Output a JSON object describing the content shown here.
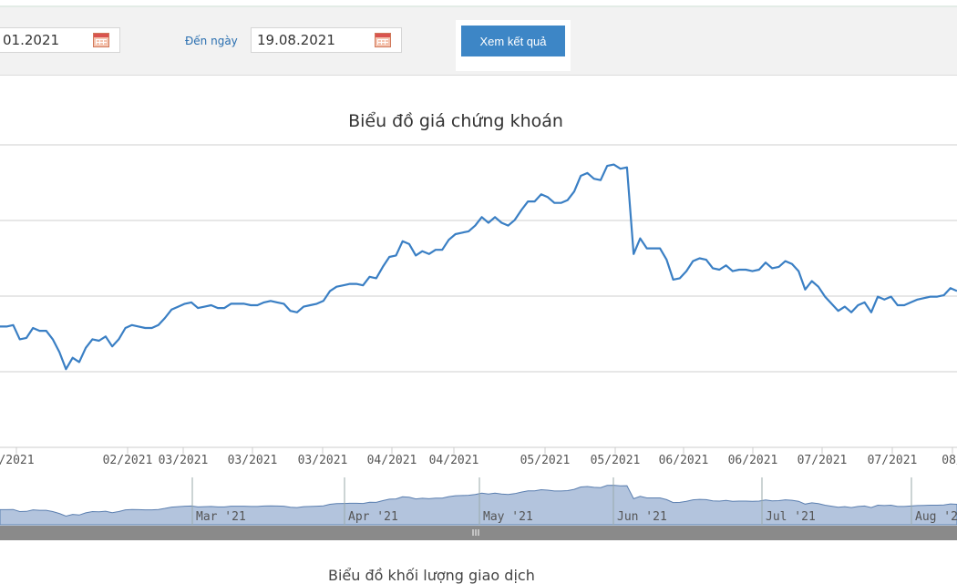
{
  "filter": {
    "from_value": "01.2021",
    "to_label": "Đến ngày",
    "to_value": "19.08.2021",
    "submit_label": "Xem kết quả"
  },
  "chart_title": "Biểu đồ giá chứng khoán",
  "next_chart_title": "Biểu đồ khối lượng giao dịch",
  "colors": {
    "line": "#3a7fc4",
    "navigator_fill": "#b3c4dd",
    "button": "#3d86c6",
    "scrollbar": "#8a8a8a"
  },
  "chart_data": {
    "type": "line",
    "title": "Biểu đồ giá chứng khoán",
    "grid": true,
    "x_tick_labels": [
      "/2021",
      "02/2021",
      "03/2021",
      "03/2021",
      "03/2021",
      "04/2021",
      "04/2021",
      "05/2021",
      "05/2021",
      "06/2021",
      "06/2021",
      "07/2021",
      "07/2021",
      "08/"
    ],
    "navigator_labels": [
      "Mar '21",
      "Apr '21",
      "May '21",
      "Jun '21",
      "Jul '21",
      "Aug '2"
    ],
    "ylim": [
      0,
      100
    ],
    "series": [
      {
        "values": [
          62.5,
          62.5,
          63.0,
          58.0,
          58.5,
          62.0,
          61.0,
          61.0,
          58.0,
          53.5,
          47.5,
          51.5,
          50.0,
          55.0,
          58.0,
          57.5,
          59.0,
          55.5,
          58.0,
          62.0,
          63.0,
          62.5,
          62.0,
          62.0,
          63.0,
          65.5,
          68.5,
          69.5,
          70.5,
          71.0,
          69.0,
          69.5,
          70.0,
          69.0,
          69.0,
          70.5,
          70.5,
          70.5,
          70.0,
          70.0,
          71.0,
          71.5,
          71.0,
          70.5,
          68.0,
          67.5,
          69.5,
          70.0,
          70.5,
          71.5,
          75.0,
          76.5,
          77.0,
          77.5,
          77.5,
          77.0,
          80.0,
          79.5,
          83.5,
          87.0,
          87.5,
          92.5,
          91.5,
          87.5,
          89.0,
          88.0,
          89.5,
          89.5,
          93.0,
          95.0,
          95.5,
          96.0,
          98.0,
          101.0,
          99.0,
          101.0,
          99.0,
          98.0,
          100.0,
          103.5,
          106.5,
          106.5,
          109.0,
          108.0,
          106.0,
          106.0,
          107.0,
          110.0,
          115.5,
          116.5,
          114.5,
          114.0,
          119.0,
          119.5,
          118.0,
          118.5,
          88.0,
          93.5,
          90.0,
          90.0,
          90.0,
          86.0,
          79.0,
          79.5,
          82.0,
          85.5,
          86.5,
          86.0,
          83.0,
          82.5,
          84.0,
          82.0,
          82.5,
          82.5,
          82.0,
          82.5,
          85.0,
          83.0,
          83.5,
          85.5,
          84.5,
          82.0,
          75.5,
          78.5,
          76.5,
          73.0,
          70.5,
          68.0,
          69.5,
          67.5,
          70.0,
          71.0,
          67.5,
          73.0,
          72.0,
          73.0,
          70.0,
          70.0,
          71.0,
          72.0,
          72.5,
          73.0,
          73.0,
          73.5,
          76.0,
          75.0
        ]
      }
    ]
  }
}
